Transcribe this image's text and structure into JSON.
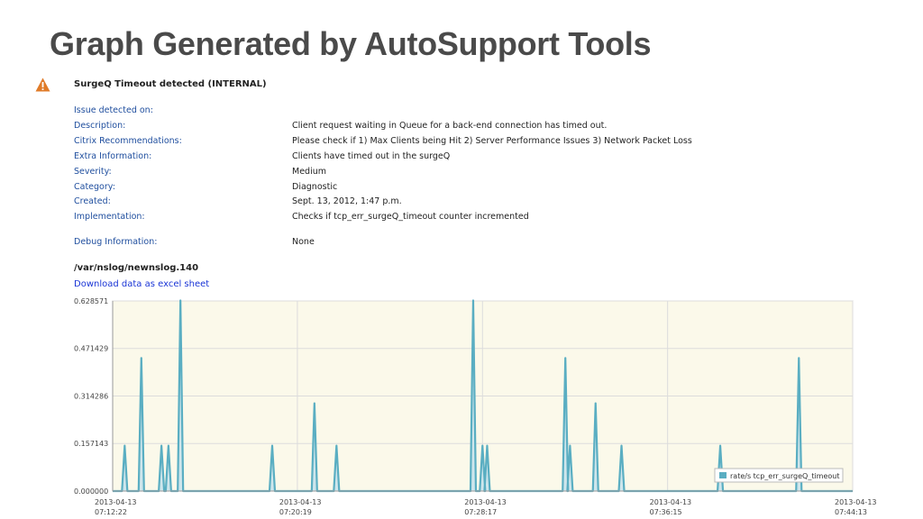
{
  "page": {
    "title": "Graph Generated by AutoSupport Tools"
  },
  "alert": {
    "icon": "warning-triangle-icon",
    "icon_color": "#e07b28",
    "title": "SurgeQ Timeout detected (INTERNAL)"
  },
  "details": [
    {
      "key": "Issue detected on:",
      "value": ""
    },
    {
      "key": "Description:",
      "value": "Client request waiting in Queue for a back-end connection has timed out."
    },
    {
      "key": "Citrix Recommendations:",
      "value": "Please check if 1) Max Clients being Hit 2) Server Performance Issues 3) Network Packet Loss"
    },
    {
      "key": "Extra Information:",
      "value": "Clients have timed out in the surgeQ"
    },
    {
      "key": "Severity:",
      "value": "Medium"
    },
    {
      "key": "Category:",
      "value": "Diagnostic"
    },
    {
      "key": "Created:",
      "value": "Sept. 13, 2012, 1:47 p.m."
    },
    {
      "key": "Implementation:",
      "value": "Checks if tcp_err_surgeQ_timeout counter incremented"
    },
    {
      "key": "Debug Information:",
      "value": "None"
    }
  ],
  "log": {
    "path": "/var/nslog/newnslog.140",
    "download_label": "Download data as excel sheet"
  },
  "chart_data": {
    "type": "area",
    "ylim": [
      0,
      0.628571
    ],
    "y_ticks": [
      "0.000000",
      "0.157143",
      "0.314286",
      "0.471429",
      "0.628571"
    ],
    "x_ticks": [
      [
        "2013-04-13",
        "07:12:22"
      ],
      [
        "2013-04-13",
        "07:20:19"
      ],
      [
        "2013-04-13",
        "07:28:17"
      ],
      [
        "2013-04-13",
        "07:36:15"
      ],
      [
        "2013-04-13",
        "07:44:13"
      ]
    ],
    "grid": true,
    "legend_position": "bottom-right",
    "line_color": "#5aaec2",
    "fill_color": "#cfe6ec",
    "background_color": "#fbf9ea",
    "series": [
      {
        "name": "rate/s tcp_err_surgeQ_timeout",
        "spikes": [
          [
            "07:12:53",
            0.15
          ],
          [
            "07:13:36",
            0.44
          ],
          [
            "07:14:28",
            0.15
          ],
          [
            "07:14:46",
            0.15
          ],
          [
            "07:15:17",
            0.63
          ],
          [
            "07:19:14",
            0.15
          ],
          [
            "07:21:03",
            0.29
          ],
          [
            "07:22:00",
            0.15
          ],
          [
            "07:27:53",
            0.63
          ],
          [
            "07:28:17",
            0.15
          ],
          [
            "07:28:29",
            0.15
          ],
          [
            "07:31:51",
            0.44
          ],
          [
            "07:32:03",
            0.15
          ],
          [
            "07:33:09",
            0.29
          ],
          [
            "07:34:16",
            0.15
          ],
          [
            "07:38:31",
            0.15
          ],
          [
            "07:41:54",
            0.44
          ]
        ]
      }
    ]
  }
}
